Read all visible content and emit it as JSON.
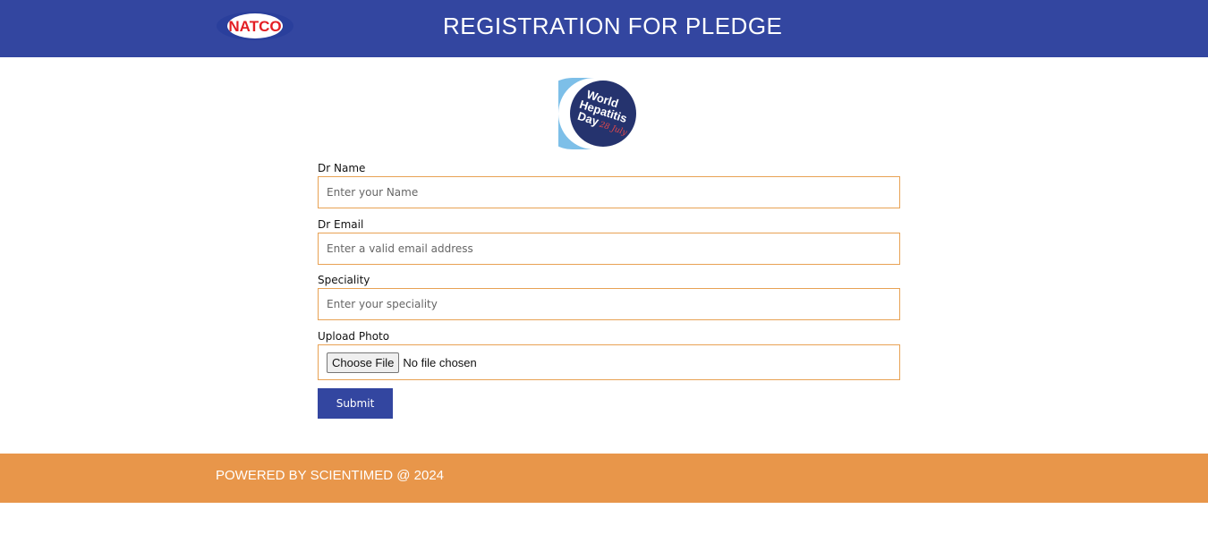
{
  "header": {
    "logo_text": "NATCO",
    "title": "REGISTRATION FOR PLEDGE"
  },
  "badge": {
    "line1": "World",
    "line2": "Hepatitis",
    "line3": "Day",
    "date": "28 July"
  },
  "form": {
    "name": {
      "label": "Dr Name",
      "placeholder": "Enter your Name",
      "value": ""
    },
    "email": {
      "label": "Dr Email",
      "placeholder": "Enter a valid email address",
      "value": ""
    },
    "speciality": {
      "label": "Speciality",
      "placeholder": "Enter your speciality",
      "value": ""
    },
    "photo": {
      "label": "Upload Photo",
      "button_label": "Choose File",
      "status": "No file chosen"
    },
    "submit_label": "Submit"
  },
  "footer": {
    "text": "POWERED BY SCIENTIMED @ 2024"
  },
  "colors": {
    "header_bg": "#3346a0",
    "footer_bg": "#e8964a",
    "input_border": "#e8a254",
    "button_bg": "#3346a0"
  }
}
